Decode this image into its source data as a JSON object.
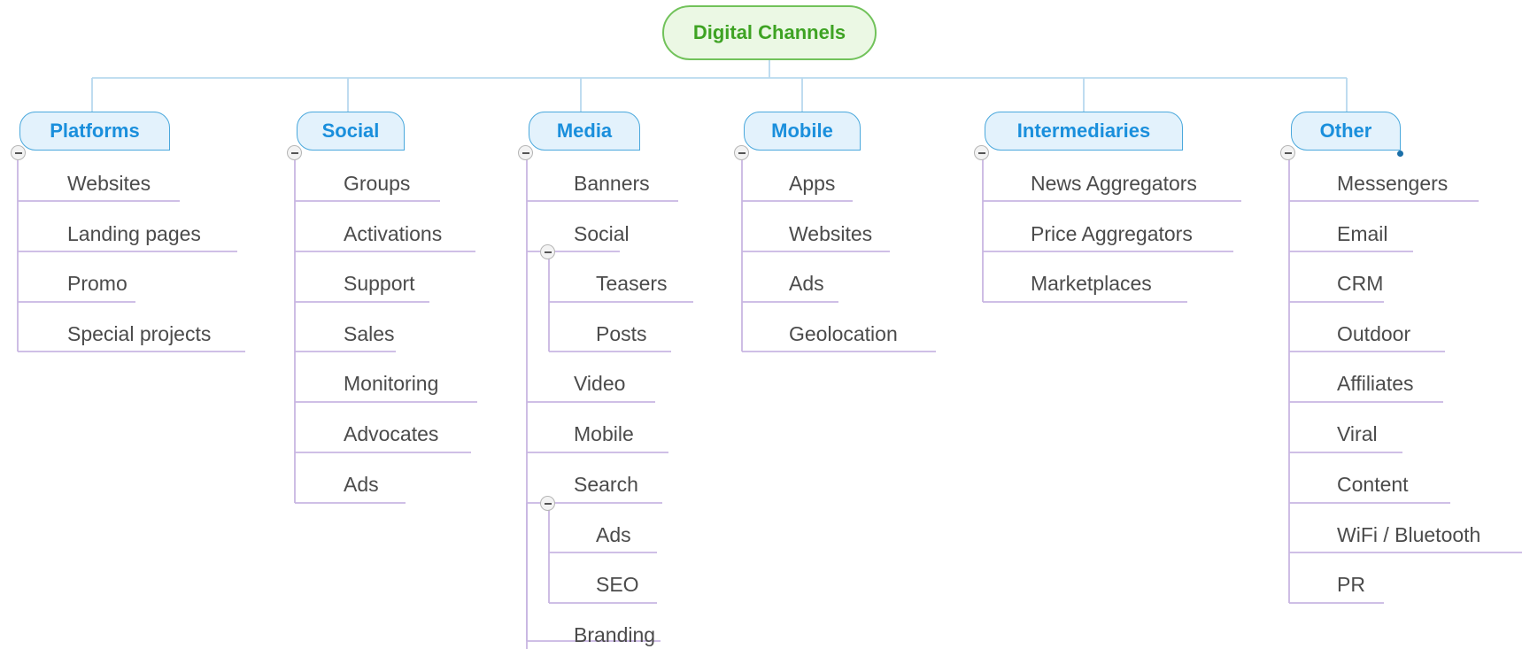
{
  "root": {
    "label": "Digital Channels"
  },
  "categories": [
    {
      "label": "Platforms",
      "items": [
        "Websites",
        "Landing pages",
        "Promo",
        "Special projects"
      ]
    },
    {
      "label": "Social",
      "items": [
        "Groups",
        "Activations",
        "Support",
        "Sales",
        "Monitoring",
        "Advocates",
        "Ads"
      ]
    },
    {
      "label": "Media",
      "items": [
        {
          "label": "Banners"
        },
        {
          "label": "Social",
          "children": [
            "Teasers",
            "Posts"
          ]
        },
        {
          "label": "Video"
        },
        {
          "label": "Mobile"
        },
        {
          "label": "Search",
          "children": [
            "Ads",
            "SEO"
          ]
        },
        {
          "label": "Branding"
        }
      ]
    },
    {
      "label": "Mobile",
      "items": [
        "Apps",
        "Websites",
        "Ads",
        "Geolocation"
      ]
    },
    {
      "label": "Intermediaries",
      "items": [
        "News Aggregators",
        "Price Aggregators",
        "Marketplaces"
      ]
    },
    {
      "label": "Other",
      "items": [
        "Messengers",
        "Email",
        "CRM",
        "Outdoor",
        "Affiliates",
        "Viral",
        "Content",
        "WiFi / Bluetooth",
        "PR"
      ]
    }
  ],
  "colors": {
    "root_border": "#71c25a",
    "root_text": "#3ea323",
    "category_border": "#4aa8dc",
    "category_text": "#1a8fdc",
    "connector": "#c8b6e2",
    "branch": "#b8d9ee"
  }
}
